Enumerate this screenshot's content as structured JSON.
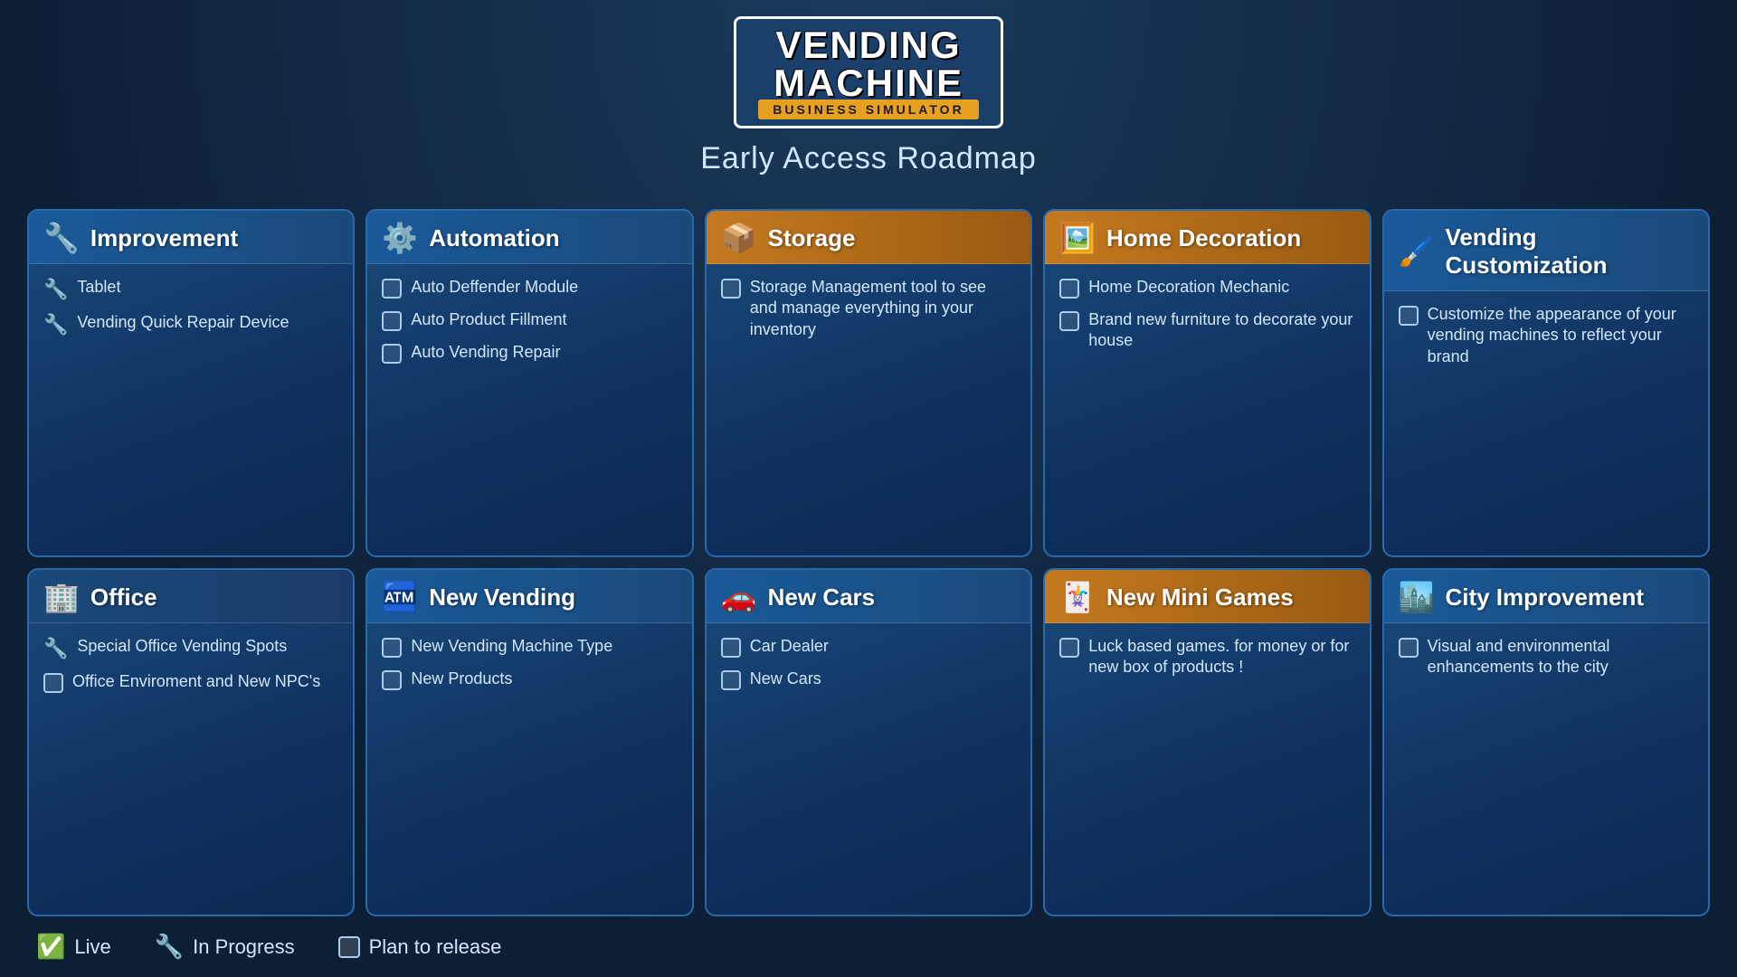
{
  "header": {
    "logo_line1": "VENDING",
    "logo_line2": "MACHINE",
    "logo_subtitle": "BUSINESS SIMULATOR",
    "page_title": "Early Access Roadmap"
  },
  "cards": [
    {
      "id": "improvement",
      "icon": "🔧",
      "title": "Improvement",
      "items": [
        {
          "type": "wrench",
          "text": "Tablet"
        },
        {
          "type": "wrench",
          "text": "Vending Quick Repair Device"
        }
      ]
    },
    {
      "id": "automation",
      "icon": "⚙️",
      "title": "Automation",
      "items": [
        {
          "type": "checkbox",
          "text": "Auto Deffender Module"
        },
        {
          "type": "checkbox",
          "text": "Auto Product Fillment"
        },
        {
          "type": "checkbox",
          "text": "Auto Vending Repair"
        }
      ]
    },
    {
      "id": "storage",
      "icon": "📦",
      "title": "Storage",
      "items": [
        {
          "type": "checkbox",
          "text": "Storage Management tool to see and manage everything in your inventory"
        }
      ]
    },
    {
      "id": "home-decoration",
      "icon": "🖼️",
      "title": "Home Decoration",
      "items": [
        {
          "type": "checkbox",
          "text": "Home Decoration Mechanic"
        },
        {
          "type": "checkbox",
          "text": "Brand new furniture to decorate your house"
        }
      ]
    },
    {
      "id": "vending-custom",
      "icon": "🖌️",
      "title": "Vending Customization",
      "items": [
        {
          "type": "checkbox",
          "text": "Customize the appearance of your vending machines to reflect your brand"
        }
      ]
    },
    {
      "id": "office",
      "icon": "🏢",
      "title": "Office",
      "items": [
        {
          "type": "wrench",
          "text": "Special Office Vending Spots"
        },
        {
          "type": "checkbox",
          "text": "Office Enviroment and New NPC's"
        }
      ]
    },
    {
      "id": "new-vending",
      "icon": "🏧",
      "title": "New Vending",
      "items": [
        {
          "type": "checkbox",
          "text": "New Vending Machine Type"
        },
        {
          "type": "checkbox",
          "text": "New Products"
        }
      ]
    },
    {
      "id": "new-cars",
      "icon": "🚗",
      "title": "New Cars",
      "items": [
        {
          "type": "checkbox",
          "text": "Car Dealer"
        },
        {
          "type": "checkbox",
          "text": "New Cars"
        }
      ]
    },
    {
      "id": "mini-games",
      "icon": "🃏",
      "title": "New Mini Games",
      "items": [
        {
          "type": "checkbox",
          "text": "Luck based games. for money or for new box of products !"
        }
      ]
    },
    {
      "id": "city-improvement",
      "icon": "🏙️",
      "title": "City Improvement",
      "items": [
        {
          "type": "checkbox",
          "text": "Visual and environmental enhancements to the city"
        }
      ]
    }
  ],
  "legend": {
    "live_label": "Live",
    "in_progress_label": "In Progress",
    "plan_label": "Plan to release"
  }
}
